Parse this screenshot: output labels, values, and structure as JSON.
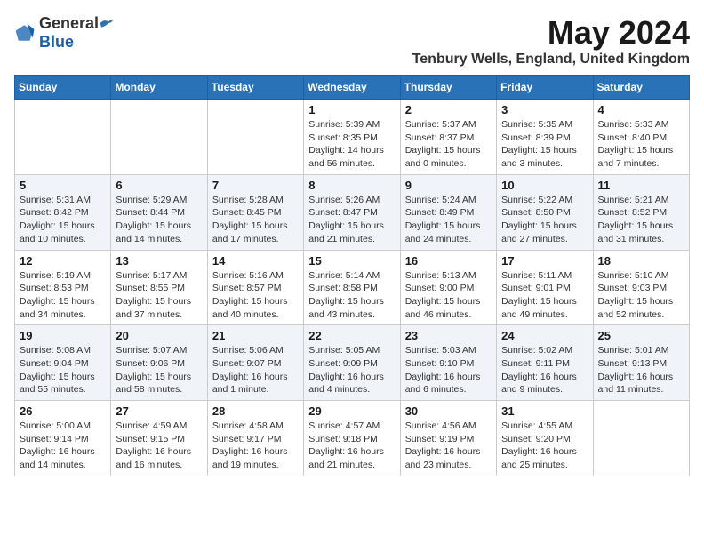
{
  "logo": {
    "general": "General",
    "blue": "Blue"
  },
  "title": "May 2024",
  "location": "Tenbury Wells, England, United Kingdom",
  "weekdays": [
    "Sunday",
    "Monday",
    "Tuesday",
    "Wednesday",
    "Thursday",
    "Friday",
    "Saturday"
  ],
  "weeks": [
    [
      {
        "day": "",
        "info": ""
      },
      {
        "day": "",
        "info": ""
      },
      {
        "day": "",
        "info": ""
      },
      {
        "day": "1",
        "info": "Sunrise: 5:39 AM\nSunset: 8:35 PM\nDaylight: 14 hours\nand 56 minutes."
      },
      {
        "day": "2",
        "info": "Sunrise: 5:37 AM\nSunset: 8:37 PM\nDaylight: 15 hours\nand 0 minutes."
      },
      {
        "day": "3",
        "info": "Sunrise: 5:35 AM\nSunset: 8:39 PM\nDaylight: 15 hours\nand 3 minutes."
      },
      {
        "day": "4",
        "info": "Sunrise: 5:33 AM\nSunset: 8:40 PM\nDaylight: 15 hours\nand 7 minutes."
      }
    ],
    [
      {
        "day": "5",
        "info": "Sunrise: 5:31 AM\nSunset: 8:42 PM\nDaylight: 15 hours\nand 10 minutes."
      },
      {
        "day": "6",
        "info": "Sunrise: 5:29 AM\nSunset: 8:44 PM\nDaylight: 15 hours\nand 14 minutes."
      },
      {
        "day": "7",
        "info": "Sunrise: 5:28 AM\nSunset: 8:45 PM\nDaylight: 15 hours\nand 17 minutes."
      },
      {
        "day": "8",
        "info": "Sunrise: 5:26 AM\nSunset: 8:47 PM\nDaylight: 15 hours\nand 21 minutes."
      },
      {
        "day": "9",
        "info": "Sunrise: 5:24 AM\nSunset: 8:49 PM\nDaylight: 15 hours\nand 24 minutes."
      },
      {
        "day": "10",
        "info": "Sunrise: 5:22 AM\nSunset: 8:50 PM\nDaylight: 15 hours\nand 27 minutes."
      },
      {
        "day": "11",
        "info": "Sunrise: 5:21 AM\nSunset: 8:52 PM\nDaylight: 15 hours\nand 31 minutes."
      }
    ],
    [
      {
        "day": "12",
        "info": "Sunrise: 5:19 AM\nSunset: 8:53 PM\nDaylight: 15 hours\nand 34 minutes."
      },
      {
        "day": "13",
        "info": "Sunrise: 5:17 AM\nSunset: 8:55 PM\nDaylight: 15 hours\nand 37 minutes."
      },
      {
        "day": "14",
        "info": "Sunrise: 5:16 AM\nSunset: 8:57 PM\nDaylight: 15 hours\nand 40 minutes."
      },
      {
        "day": "15",
        "info": "Sunrise: 5:14 AM\nSunset: 8:58 PM\nDaylight: 15 hours\nand 43 minutes."
      },
      {
        "day": "16",
        "info": "Sunrise: 5:13 AM\nSunset: 9:00 PM\nDaylight: 15 hours\nand 46 minutes."
      },
      {
        "day": "17",
        "info": "Sunrise: 5:11 AM\nSunset: 9:01 PM\nDaylight: 15 hours\nand 49 minutes."
      },
      {
        "day": "18",
        "info": "Sunrise: 5:10 AM\nSunset: 9:03 PM\nDaylight: 15 hours\nand 52 minutes."
      }
    ],
    [
      {
        "day": "19",
        "info": "Sunrise: 5:08 AM\nSunset: 9:04 PM\nDaylight: 15 hours\nand 55 minutes."
      },
      {
        "day": "20",
        "info": "Sunrise: 5:07 AM\nSunset: 9:06 PM\nDaylight: 15 hours\nand 58 minutes."
      },
      {
        "day": "21",
        "info": "Sunrise: 5:06 AM\nSunset: 9:07 PM\nDaylight: 16 hours\nand 1 minute."
      },
      {
        "day": "22",
        "info": "Sunrise: 5:05 AM\nSunset: 9:09 PM\nDaylight: 16 hours\nand 4 minutes."
      },
      {
        "day": "23",
        "info": "Sunrise: 5:03 AM\nSunset: 9:10 PM\nDaylight: 16 hours\nand 6 minutes."
      },
      {
        "day": "24",
        "info": "Sunrise: 5:02 AM\nSunset: 9:11 PM\nDaylight: 16 hours\nand 9 minutes."
      },
      {
        "day": "25",
        "info": "Sunrise: 5:01 AM\nSunset: 9:13 PM\nDaylight: 16 hours\nand 11 minutes."
      }
    ],
    [
      {
        "day": "26",
        "info": "Sunrise: 5:00 AM\nSunset: 9:14 PM\nDaylight: 16 hours\nand 14 minutes."
      },
      {
        "day": "27",
        "info": "Sunrise: 4:59 AM\nSunset: 9:15 PM\nDaylight: 16 hours\nand 16 minutes."
      },
      {
        "day": "28",
        "info": "Sunrise: 4:58 AM\nSunset: 9:17 PM\nDaylight: 16 hours\nand 19 minutes."
      },
      {
        "day": "29",
        "info": "Sunrise: 4:57 AM\nSunset: 9:18 PM\nDaylight: 16 hours\nand 21 minutes."
      },
      {
        "day": "30",
        "info": "Sunrise: 4:56 AM\nSunset: 9:19 PM\nDaylight: 16 hours\nand 23 minutes."
      },
      {
        "day": "31",
        "info": "Sunrise: 4:55 AM\nSunset: 9:20 PM\nDaylight: 16 hours\nand 25 minutes."
      },
      {
        "day": "",
        "info": ""
      }
    ]
  ]
}
